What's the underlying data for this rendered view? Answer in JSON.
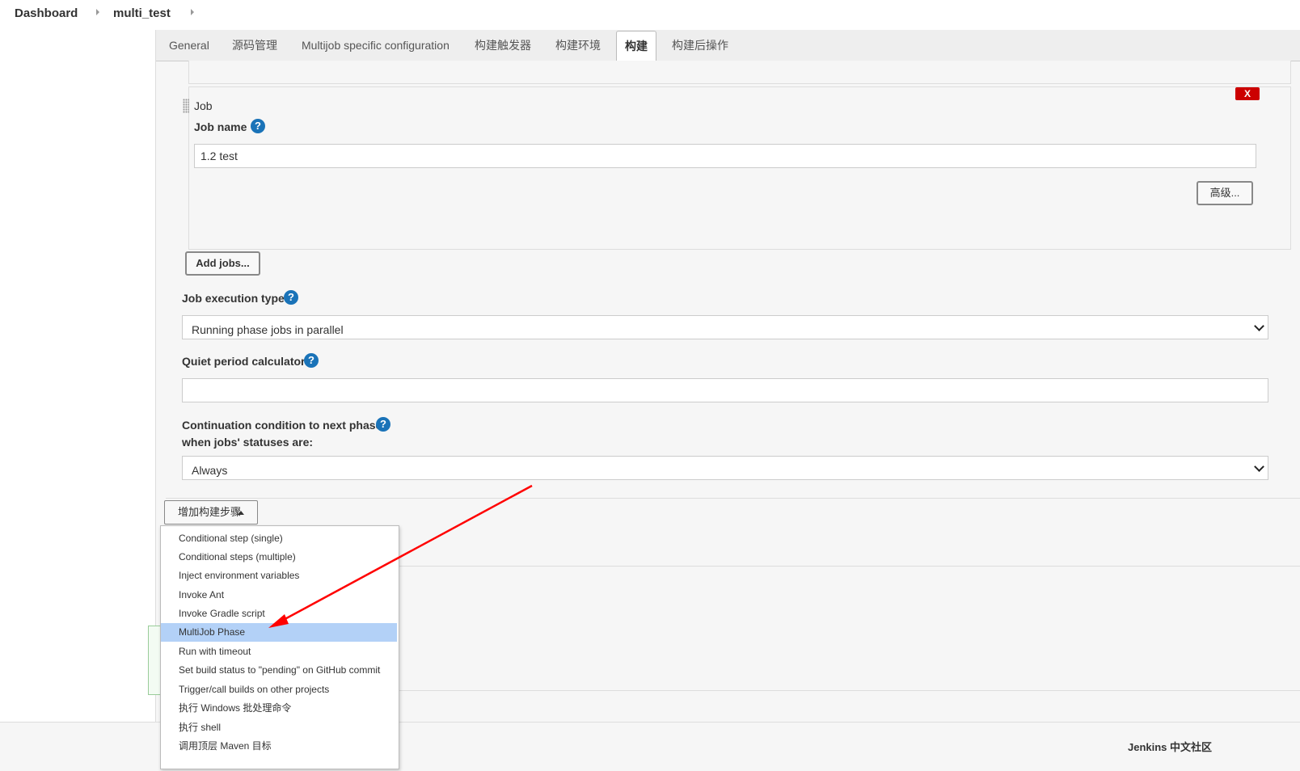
{
  "breadcrumb": {
    "items": [
      "Dashboard",
      "multi_test"
    ]
  },
  "tabs": [
    "General",
    "源码管理",
    "Multijob specific configuration",
    "构建触发器",
    "构建环境",
    "构建",
    "构建后操作"
  ],
  "active_tab": "构建",
  "job": {
    "section_label": "Job",
    "delete_label": "X",
    "job_name_label": "Job name",
    "job_name_value": "1.2 test",
    "advanced_button": "高级...",
    "help_glyph": "?"
  },
  "add_jobs_button": "Add jobs...",
  "execution_type": {
    "label": "Job execution type",
    "value": "Running phase jobs in parallel"
  },
  "quiet_period": {
    "label": "Quiet period calculator",
    "value": ""
  },
  "continuation": {
    "label_line1": "Continuation condition to next phase",
    "label_line2": "when jobs' statuses are:",
    "value": "Always"
  },
  "add_build_step": {
    "label": "增加构建步骤"
  },
  "menu": {
    "items": [
      "Conditional step (single)",
      "Conditional steps (multiple)",
      "Inject environment variables",
      "Invoke Ant",
      "Invoke Gradle script",
      "MultiJob Phase",
      "Run with timeout",
      "Set build status to \"pending\" on GitHub commit",
      "Trigger/call builds on other projects",
      "执行 Windows 批处理命令",
      "执行 shell",
      "调用顶层 Maven 目标"
    ],
    "selected": "MultiJob Phase"
  },
  "footer": {
    "brand": "Jenkins 中文社区"
  },
  "colors": {
    "accent": "#1a73b8",
    "danger": "#cc0000",
    "selection": "#b3d1f7",
    "annotation_arrow": "#ff0000"
  }
}
